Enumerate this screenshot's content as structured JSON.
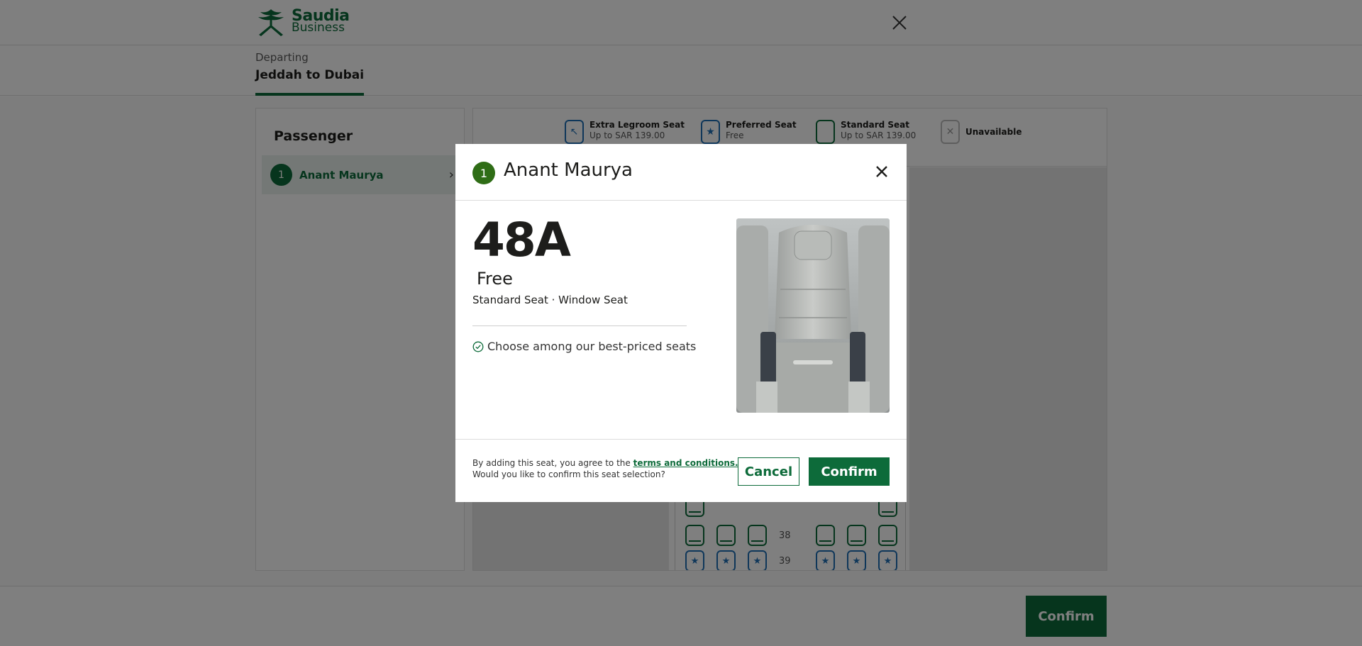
{
  "brand": {
    "name": "Saudia",
    "sub": "Business",
    "color": "#0d6b3a"
  },
  "route": {
    "caption": "Departing",
    "title": "Jeddah to Dubai"
  },
  "passenger_panel": {
    "title": "Passenger",
    "passenger": {
      "number": "1",
      "name": "Anant Maurya"
    }
  },
  "legend": [
    {
      "label": "Extra Legroom Seat",
      "sub": "Up to SAR 139.00",
      "icon": "extra-legroom-seat-icon"
    },
    {
      "label": "Preferred Seat",
      "sub": "Free",
      "icon": "preferred-seat-icon"
    },
    {
      "label": "Standard Seat",
      "sub": "Up to SAR 139.00",
      "icon": "standard-seat-icon"
    },
    {
      "label": "Unavailable",
      "sub": "",
      "icon": "unavailable-seat-icon"
    }
  ],
  "seat_rows": [
    {
      "label": "38",
      "type": "standard"
    },
    {
      "label": "39",
      "type": "preferred"
    }
  ],
  "footer": {
    "confirm_label": "Confirm"
  },
  "modal": {
    "passenger_number": "1",
    "passenger_name": "Anant Maurya",
    "seat_code": "48A",
    "price": "Free",
    "description": "Standard Seat · Window Seat",
    "benefit": "Choose among our best-priced seats",
    "terms_prefix": "By adding this seat, you agree to the ",
    "terms_link": "terms and conditions.",
    "terms_question": "Would you like to confirm this seat selection?",
    "cancel_label": "Cancel",
    "confirm_label": "Confirm"
  }
}
